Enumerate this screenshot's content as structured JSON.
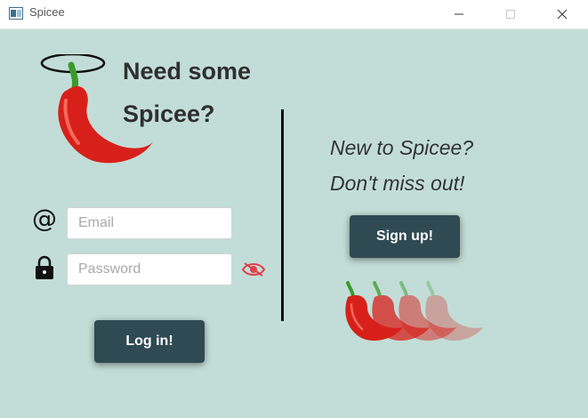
{
  "window": {
    "title": "Spicee",
    "controls": [
      "minimize",
      "maximize",
      "close"
    ]
  },
  "login": {
    "headline_line1": "Need some",
    "headline_line2": "Spicee?",
    "email_placeholder": "Email",
    "email_value": "",
    "password_placeholder": "Password",
    "password_value": "",
    "login_button": "Log in!"
  },
  "signup": {
    "tagline_line1": "New to Spicee?",
    "tagline_line2": "Don't miss out!",
    "signup_button": "Sign up!"
  },
  "icons": {
    "email": "at-sign-icon",
    "password": "lock-icon",
    "toggle_visibility": "eye-slash-icon",
    "logo": "chili-pepper-halo-icon"
  },
  "colors": {
    "background": "#c2ddd7",
    "button": "#2f4a52",
    "pepper": "#d8201a",
    "stem": "#3a9a2a"
  }
}
